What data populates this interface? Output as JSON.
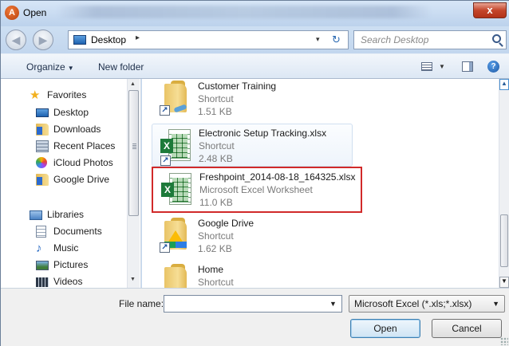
{
  "window": {
    "title": "Open",
    "app_icon_letter": "A",
    "close_glyph": "x"
  },
  "address": {
    "location": "Desktop",
    "separator": "▸",
    "dropdown_glyph": "▾",
    "refresh_glyph": "↻",
    "search_placeholder": "Search Desktop",
    "back_glyph": "◀",
    "forward_glyph": "▶"
  },
  "toolbar": {
    "organize_label": "Organize",
    "organize_caret": "▼",
    "new_folder_label": "New folder",
    "view_caret": "▼",
    "help_glyph": "?"
  },
  "nav": {
    "favorites": [
      {
        "label": "Favorites",
        "icon": "star-icon"
      },
      {
        "label": "Desktop",
        "icon": "desktop-icon"
      },
      {
        "label": "Downloads",
        "icon": "downloads-icon"
      },
      {
        "label": "Recent Places",
        "icon": "recent-places-icon"
      },
      {
        "label": "iCloud Photos",
        "icon": "icloud-photos-icon"
      },
      {
        "label": "Google Drive",
        "icon": "google-drive-icon"
      }
    ],
    "libraries": [
      {
        "label": "Libraries",
        "icon": "libraries-icon"
      },
      {
        "label": "Documents",
        "icon": "documents-icon"
      },
      {
        "label": "Music",
        "icon": "music-icon"
      },
      {
        "label": "Pictures",
        "icon": "pictures-icon"
      },
      {
        "label": "Videos",
        "icon": "videos-icon"
      }
    ],
    "scroll_up": "▲",
    "scroll_down": "▼"
  },
  "files": [
    {
      "name": "Customer Training",
      "type": "Shortcut",
      "size": "1.51 KB",
      "icon": "folder-shortcut-icon"
    },
    {
      "name": "Electronic Setup Tracking.xlsx",
      "type": "Shortcut",
      "size": "2.48 KB",
      "icon": "excel-shortcut-icon"
    },
    {
      "name": "Freshpoint_2014-08-18_164325.xlsx",
      "type": "Microsoft Excel Worksheet",
      "size": "11.0 KB",
      "icon": "excel-file-icon"
    },
    {
      "name": "Google Drive",
      "type": "Shortcut",
      "size": "1.62 KB",
      "icon": "google-drive-folder-icon"
    },
    {
      "name": "Home",
      "type": "Shortcut",
      "size": "",
      "icon": "folder-shortcut-icon"
    }
  ],
  "file_scroll": {
    "up": "▲",
    "down": "▼"
  },
  "bottom": {
    "file_name_label": "File name:",
    "file_name_value": "",
    "file_name_caret": "▼",
    "filter_value": "Microsoft Excel (*.xls;*.xlsx)",
    "filter_caret": "▼",
    "open_label": "Open",
    "cancel_label": "Cancel"
  },
  "colors": {
    "highlight_border": "#d12a2a",
    "title_gradient_top": "#d7e6f7",
    "close_red": "#c4452a"
  }
}
